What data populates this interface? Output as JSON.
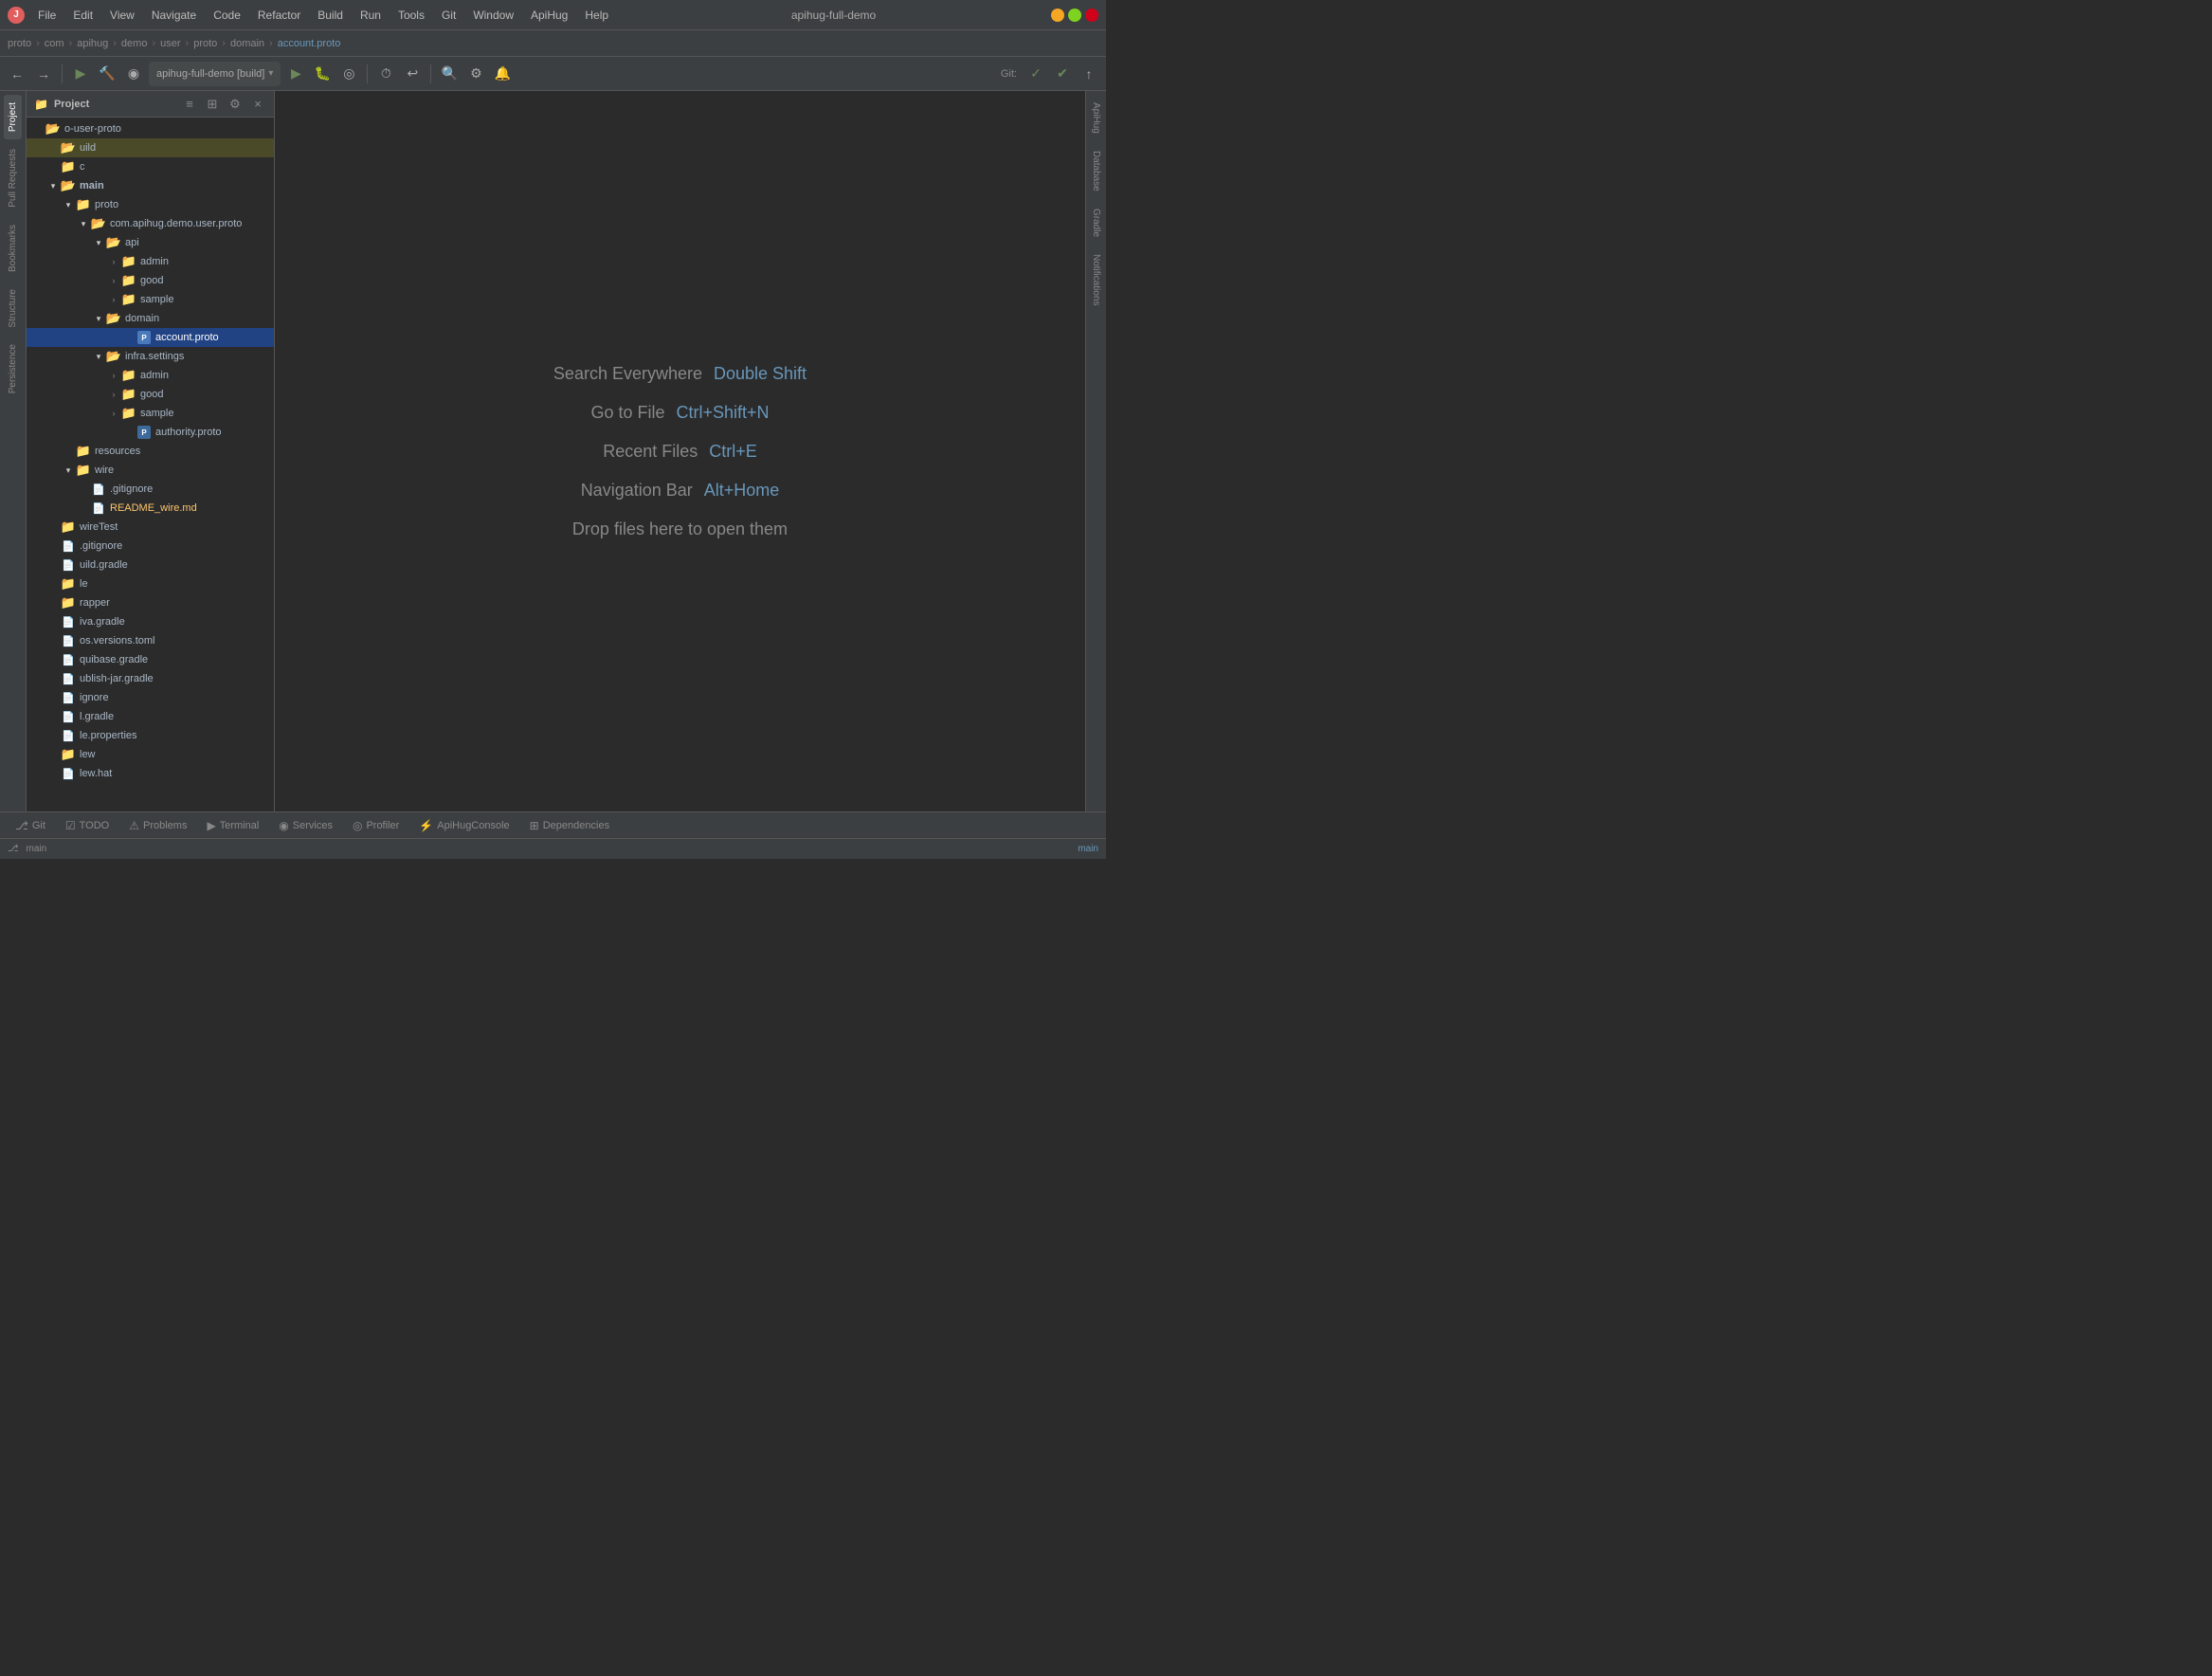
{
  "title_bar": {
    "logo": "J",
    "title": "apihug-full-demo",
    "menu_items": [
      "File",
      "Edit",
      "View",
      "Navigate",
      "Code",
      "Refactor",
      "Build",
      "Run",
      "Tools",
      "Git",
      "Window",
      "ApiHug",
      "Help"
    ]
  },
  "breadcrumb": {
    "items": [
      "proto",
      "com",
      "apihug",
      "demo",
      "user",
      "proto",
      "domain"
    ],
    "active": "account.proto"
  },
  "toolbar": {
    "run_config": "apihug-full-demo [build]",
    "git_label": "Git:"
  },
  "project_panel": {
    "title": "Project",
    "root": "o-user-proto",
    "tree": [
      {
        "id": 1,
        "label": "uild",
        "indent": 0,
        "type": "folder-open",
        "highlighted": true
      },
      {
        "id": 2,
        "label": "c",
        "indent": 0,
        "type": "folder"
      },
      {
        "id": 3,
        "label": "main",
        "indent": 0,
        "type": "folder-open",
        "bold": true
      },
      {
        "id": 4,
        "label": "proto",
        "indent": 1,
        "type": "folder-blue"
      },
      {
        "id": 5,
        "label": "com.apihug.demo.user.proto",
        "indent": 2,
        "type": "folder-open"
      },
      {
        "id": 6,
        "label": "api",
        "indent": 3,
        "type": "folder-open"
      },
      {
        "id": 7,
        "label": "admin",
        "indent": 4,
        "type": "folder",
        "collapsed": true
      },
      {
        "id": 8,
        "label": "good",
        "indent": 4,
        "type": "folder",
        "collapsed": true
      },
      {
        "id": 9,
        "label": "sample",
        "indent": 4,
        "type": "folder",
        "collapsed": true
      },
      {
        "id": 10,
        "label": "domain",
        "indent": 3,
        "type": "folder-open"
      },
      {
        "id": 11,
        "label": "account.proto",
        "indent": 5,
        "type": "proto",
        "selected": true
      },
      {
        "id": 12,
        "label": "infra.settings",
        "indent": 3,
        "type": "folder-open"
      },
      {
        "id": 13,
        "label": "admin",
        "indent": 4,
        "type": "folder",
        "collapsed": true
      },
      {
        "id": 14,
        "label": "good",
        "indent": 4,
        "type": "folder",
        "collapsed": true
      },
      {
        "id": 15,
        "label": "sample",
        "indent": 4,
        "type": "folder",
        "collapsed": true
      },
      {
        "id": 16,
        "label": "authority.proto",
        "indent": 5,
        "type": "proto"
      },
      {
        "id": 17,
        "label": "resources",
        "indent": 1,
        "type": "folder"
      },
      {
        "id": 18,
        "label": "wire",
        "indent": 1,
        "type": "folder-blue"
      },
      {
        "id": 19,
        "label": ".gitignore",
        "indent": 2,
        "type": "file"
      },
      {
        "id": 20,
        "label": "README_wire.md",
        "indent": 2,
        "type": "file-md"
      },
      {
        "id": 21,
        "label": "wireTest",
        "indent": 0,
        "type": "folder"
      },
      {
        "id": 22,
        "label": ".gitignore",
        "indent": 0,
        "type": "file"
      },
      {
        "id": 23,
        "label": "uild.gradle",
        "indent": 0,
        "type": "file"
      },
      {
        "id": 24,
        "label": "le",
        "indent": 0,
        "type": "folder"
      },
      {
        "id": 25,
        "label": "rapper",
        "indent": 0,
        "type": "folder"
      },
      {
        "id": 26,
        "label": "iva.gradle",
        "indent": 0,
        "type": "file"
      },
      {
        "id": 27,
        "label": "os.versions.toml",
        "indent": 0,
        "type": "file"
      },
      {
        "id": 28,
        "label": "quibase.gradle",
        "indent": 0,
        "type": "file"
      },
      {
        "id": 29,
        "label": "ublish-jar.gradle",
        "indent": 0,
        "type": "file"
      },
      {
        "id": 30,
        "label": "ignore",
        "indent": 0,
        "type": "file"
      },
      {
        "id": 31,
        "label": "l.gradle",
        "indent": 0,
        "type": "file"
      },
      {
        "id": 32,
        "label": "le.properties",
        "indent": 0,
        "type": "file"
      },
      {
        "id": 33,
        "label": "lew",
        "indent": 0,
        "type": "folder"
      },
      {
        "id": 34,
        "label": "lew.hat",
        "indent": 0,
        "type": "file"
      }
    ]
  },
  "content_area": {
    "hints": [
      {
        "label": "Search Everywhere",
        "shortcut": "Double Shift"
      },
      {
        "label": "Go to File",
        "shortcut": "Ctrl+Shift+N"
      },
      {
        "label": "Recent Files",
        "shortcut": "Ctrl+E"
      },
      {
        "label": "Navigation Bar",
        "shortcut": "Alt+Home"
      },
      {
        "label": "Drop files here to open them",
        "shortcut": ""
      }
    ]
  },
  "right_panels": [
    "ApiHug",
    "Database",
    "Gradle",
    "Notifications"
  ],
  "bottom_tabs": [
    {
      "label": "Git",
      "icon": "⎇",
      "active": false
    },
    {
      "label": "TODO",
      "icon": "☑",
      "active": false
    },
    {
      "label": "Problems",
      "icon": "⚠",
      "active": false
    },
    {
      "label": "Terminal",
      "icon": "▶",
      "active": false
    },
    {
      "label": "Services",
      "icon": "◉",
      "active": false
    },
    {
      "label": "Profiler",
      "icon": "◎",
      "active": false
    },
    {
      "label": "ApiHugConsole",
      "icon": "⚡",
      "active": false
    },
    {
      "label": "Dependencies",
      "icon": "📦",
      "active": false
    }
  ],
  "status_bar": {
    "right_text": "main"
  },
  "left_side_labels": [
    "Project",
    "Pull Requests",
    "Bookmarks",
    "Structure",
    "Persistence"
  ]
}
